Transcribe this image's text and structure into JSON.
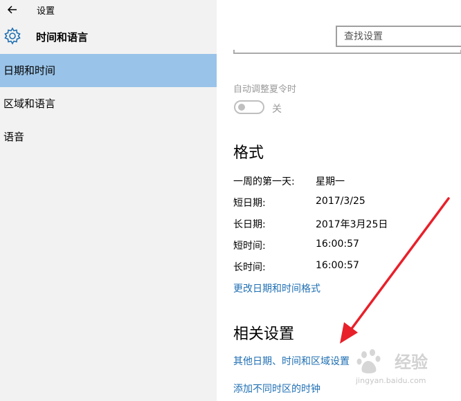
{
  "window": {
    "title": "设置"
  },
  "header": {
    "title": "时间和语言"
  },
  "search": {
    "placeholder": "查找设置"
  },
  "sidebar": {
    "items": [
      {
        "label": "日期和时间",
        "active": true
      },
      {
        "label": "区域和语言",
        "active": false
      },
      {
        "label": "语音",
        "active": false
      }
    ]
  },
  "dst": {
    "label": "自动调整夏令时",
    "state_label": "关",
    "on": false
  },
  "format": {
    "heading": "格式",
    "rows": [
      {
        "label": "一周的第一天:",
        "value": "星期一"
      },
      {
        "label": "短日期:",
        "value": "2017/3/25"
      },
      {
        "label": "长日期:",
        "value": "2017年3月25日"
      },
      {
        "label": "短时间:",
        "value": "16:00:57"
      },
      {
        "label": "长时间:",
        "value": "16:00:57"
      }
    ],
    "change_link": "更改日期和时间格式"
  },
  "related": {
    "heading": "相关设置",
    "links": [
      "其他日期、时间和区域设置",
      "添加不同时区的时钟"
    ]
  },
  "watermark": {
    "brand": "经验",
    "url": "jingyan.baidu.com"
  },
  "colors": {
    "accent": "#99c3e8",
    "link": "#1f6fb3",
    "arrow": "#e8202a"
  }
}
